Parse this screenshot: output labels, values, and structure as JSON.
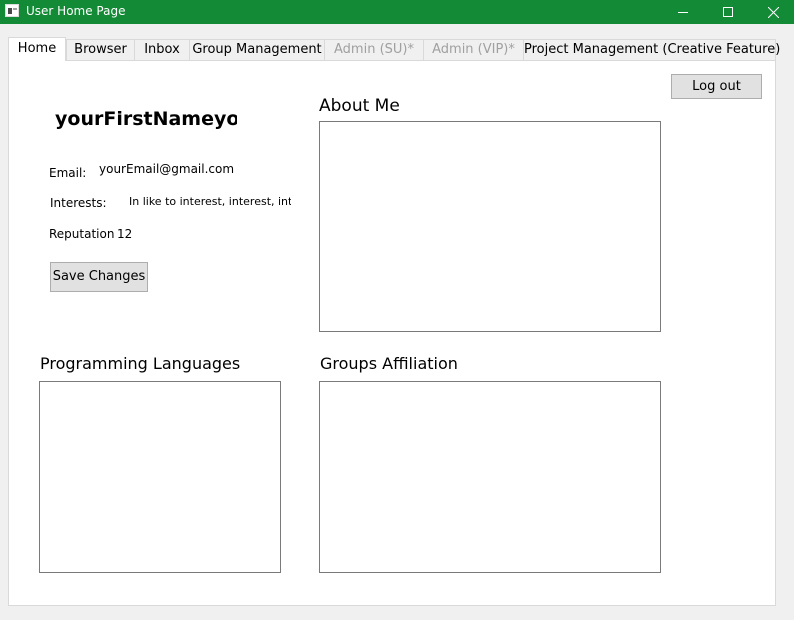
{
  "window": {
    "title": "User Home Page",
    "icons": {
      "app": "app-icon",
      "minimize": "minimize-icon",
      "maximize": "maximize-icon",
      "close": "close-icon"
    }
  },
  "tabs": [
    {
      "label": "Home",
      "active": true,
      "enabled": true
    },
    {
      "label": "Browser",
      "active": false,
      "enabled": true
    },
    {
      "label": "Inbox",
      "active": false,
      "enabled": true
    },
    {
      "label": "Group Management",
      "active": false,
      "enabled": true
    },
    {
      "label": "Admin (SU)*",
      "active": false,
      "enabled": false
    },
    {
      "label": "Admin (VIP)*",
      "active": false,
      "enabled": false
    },
    {
      "label": "Project Management (Creative Feature)",
      "active": false,
      "enabled": true
    }
  ],
  "home": {
    "logout_label": "Log out",
    "name": "yourFirstNameyourLastName",
    "email_label": "Email:",
    "email_value": "yourEmail@gmail.com",
    "interests_label": "Interests:",
    "interests_value": "In like to interest, interest, interest",
    "reputation_label": "Reputation",
    "reputation_value": "12",
    "save_label": "Save Changes",
    "about_heading": "About Me",
    "languages_heading": "Programming Languages",
    "groups_heading": "Groups Affiliation"
  },
  "colors": {
    "titlebar": "#138a36",
    "disabled_text": "#a0a0a0",
    "button_bg": "#e1e1e1"
  }
}
